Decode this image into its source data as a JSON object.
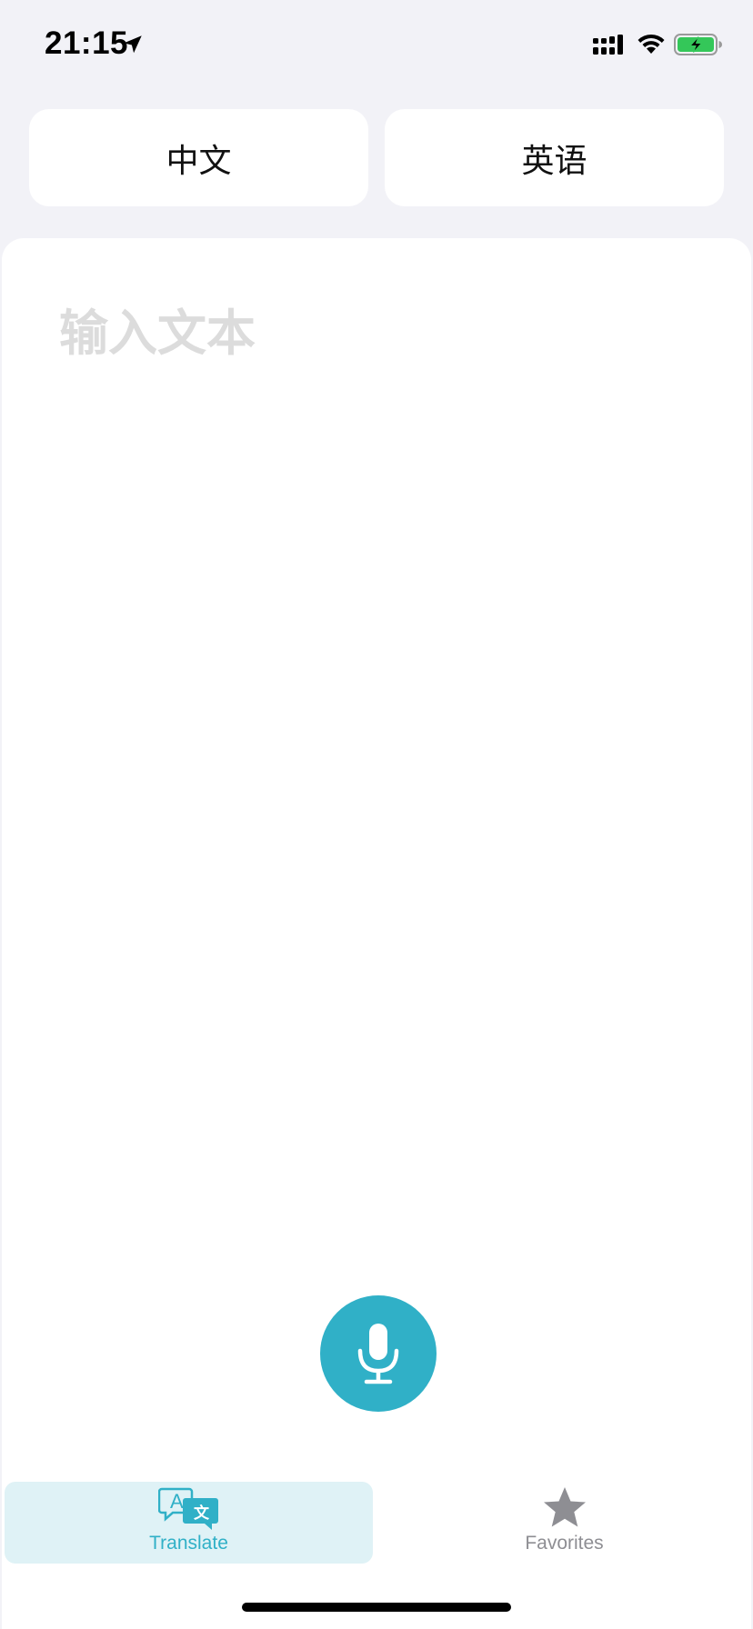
{
  "status_bar": {
    "time": "21:15",
    "icons": [
      "location-arrow-icon",
      "cellular-signal-icon",
      "wifi-icon",
      "battery-charging-icon"
    ]
  },
  "language_selector": {
    "source_label": "中文",
    "target_label": "英语"
  },
  "input": {
    "placeholder": "输入文本",
    "value": ""
  },
  "mic_button": {
    "icon": "microphone-icon"
  },
  "tab_bar": {
    "tabs": [
      {
        "label": "Translate",
        "icon": "translate-icon",
        "selected": true
      },
      {
        "label": "Favorites",
        "icon": "star-icon",
        "selected": false
      }
    ]
  },
  "colors": {
    "accent": "#30b0c7",
    "tab_selected_bg": "#dff2f6",
    "inactive": "#8e8e93",
    "background": "#f2f2f7",
    "battery_fill": "#34c759"
  }
}
